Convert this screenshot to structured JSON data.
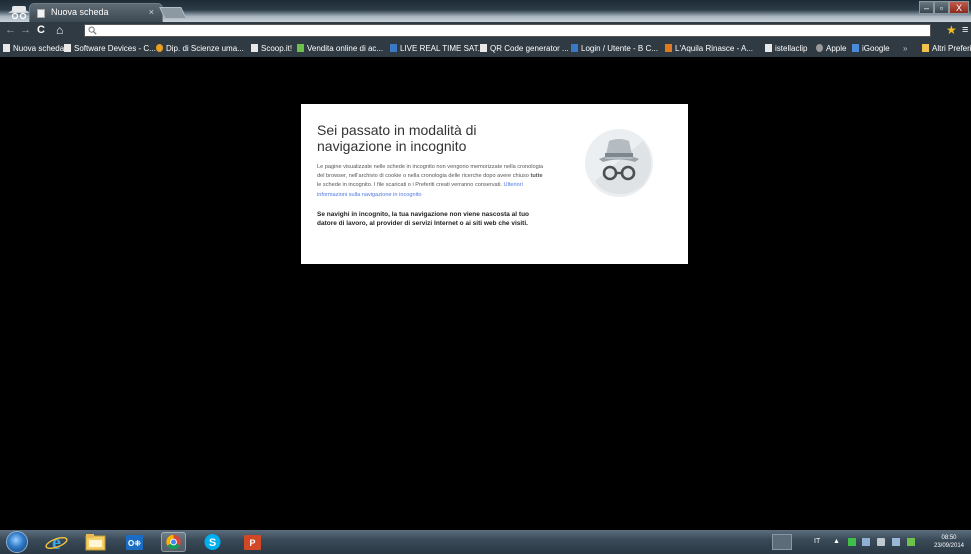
{
  "window": {
    "controls": {
      "minimize": "–",
      "maximize": "▫",
      "close": "X"
    }
  },
  "tabs": [
    {
      "title": "Nuova scheda",
      "close": "×"
    }
  ],
  "toolbar": {
    "back_icon": "←",
    "forward_icon": "→",
    "reload_icon": "C",
    "home_icon": "⌂",
    "search_icon": "magnifier",
    "url_value": "",
    "star_icon": "★",
    "menu_icon": "≡"
  },
  "bookmarks": [
    {
      "label": "Nuova scheda",
      "icon": "page"
    },
    {
      "label": "Software Devices - C...",
      "icon": "page"
    },
    {
      "label": "Dip. di Scienze uma...",
      "icon": "globe"
    },
    {
      "label": "Scoop.it!",
      "icon": "page"
    },
    {
      "label": "Vendita online di ac...",
      "icon": "green"
    },
    {
      "label": "LIVE REAL TIME SAT...",
      "icon": "blue"
    },
    {
      "label": "QR Code generator ...",
      "icon": "page"
    },
    {
      "label": "Login / Utente - B C...",
      "icon": "blue"
    },
    {
      "label": "L'Aquila Rinasce - A...",
      "icon": "orange"
    },
    {
      "label": "istellaclip",
      "icon": "page"
    },
    {
      "label": "Apple",
      "icon": "gray"
    },
    {
      "label": "iGoogle",
      "icon": "blue"
    },
    {
      "label": "»",
      "icon": "none"
    },
    {
      "label": "Altri Preferiti",
      "icon": "folder"
    }
  ],
  "incognito": {
    "title": "Sei passato in modalità di navigazione in incognito",
    "body_part1": "Le pagine visualizzate nelle schede in incognito non vengono memorizzate nella cronologia del browser, nell'archivio di cookie o nella cronologia delle ricerche dopo avere chiuso ",
    "body_bold": "tutte",
    "body_part2": " le schede in incognito. I file scaricati o i Preferiti creati verranno conservati. ",
    "link": "Ulteriori informazioni sulla navigazione in incognito",
    "warning": "Se navighi in incognito, la tua navigazione non viene nascosta al tuo datore di lavoro, al provider di servizi Internet o ai siti web che visiti."
  },
  "taskbar": {
    "apps": [
      "internet-explorer",
      "windows-explorer",
      "outlook",
      "chrome",
      "skype",
      "powerpoint"
    ],
    "tray_lang": "IT",
    "tray_arrow": "▲",
    "clock_time": "08:50",
    "clock_date": "23/09/2014"
  },
  "colors": {
    "tab_active": "#4a5660",
    "link": "#4d7ae0",
    "page_background": "#000000"
  }
}
